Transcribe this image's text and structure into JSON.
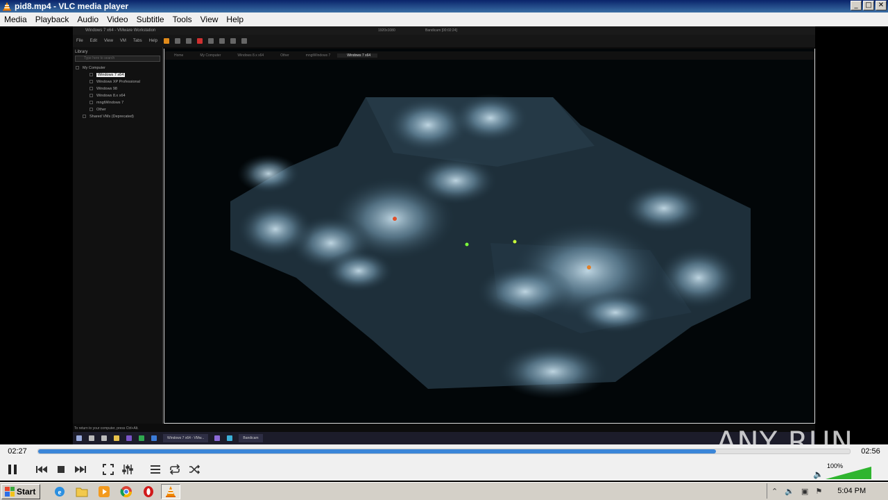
{
  "window": {
    "title": "pid8.mp4 - VLC media player",
    "icon": "vlc-cone-icon",
    "buttons": {
      "minimize": "_",
      "maximize": "□",
      "close": "✕"
    }
  },
  "menu": [
    "Media",
    "Playback",
    "Audio",
    "Video",
    "Subtitle",
    "Tools",
    "View",
    "Help"
  ],
  "video_content": {
    "vmware_title": "Windows 7 x64 - VMware Workstation",
    "vmware_menu": [
      "File",
      "Edit",
      "View",
      "VM",
      "Tabs",
      "Help"
    ],
    "resolution": "1920x1080",
    "recording": "Bandicam [00:02:24]",
    "library": {
      "header": "Library",
      "search_placeholder": "Type here to search",
      "tree": [
        {
          "label": "My Computer"
        },
        {
          "label": "Windows 7 x64",
          "selected": true
        },
        {
          "label": "Windows XP Professional"
        },
        {
          "label": "Windows 98"
        },
        {
          "label": "Windows 8.x x64"
        },
        {
          "label": "mngtWindows 7"
        },
        {
          "label": "Other"
        },
        {
          "label": "Shared VMs (Deprecated)"
        }
      ]
    },
    "tabs": [
      "Home",
      "My Computer",
      "Windows 8.x x64",
      "Other",
      "mngtWindows 7",
      "Windows 7 x64"
    ],
    "hint": "To return to your computer, press Ctrl+Alt.",
    "taskbar_tasks": [
      "Windows 7 x64 - VMw...",
      "Bandicam"
    ]
  },
  "watermark": "ANY RUN",
  "playback": {
    "elapsed": "02:27",
    "total": "02:56",
    "progress": 0.835
  },
  "controls": {
    "play_pause": "pause",
    "volume_percent": "100%"
  },
  "taskbar": {
    "start_label": "Start",
    "clock": "5:04 PM",
    "apps": [
      "internet-explorer-icon",
      "folder-icon",
      "media-player-icon",
      "chrome-icon",
      "opera-icon",
      "vlc-icon"
    ]
  },
  "colors": {
    "seek_fill": "#3b86d8",
    "title_bar": "#0a246a",
    "volume_green": "#2fb52f"
  }
}
